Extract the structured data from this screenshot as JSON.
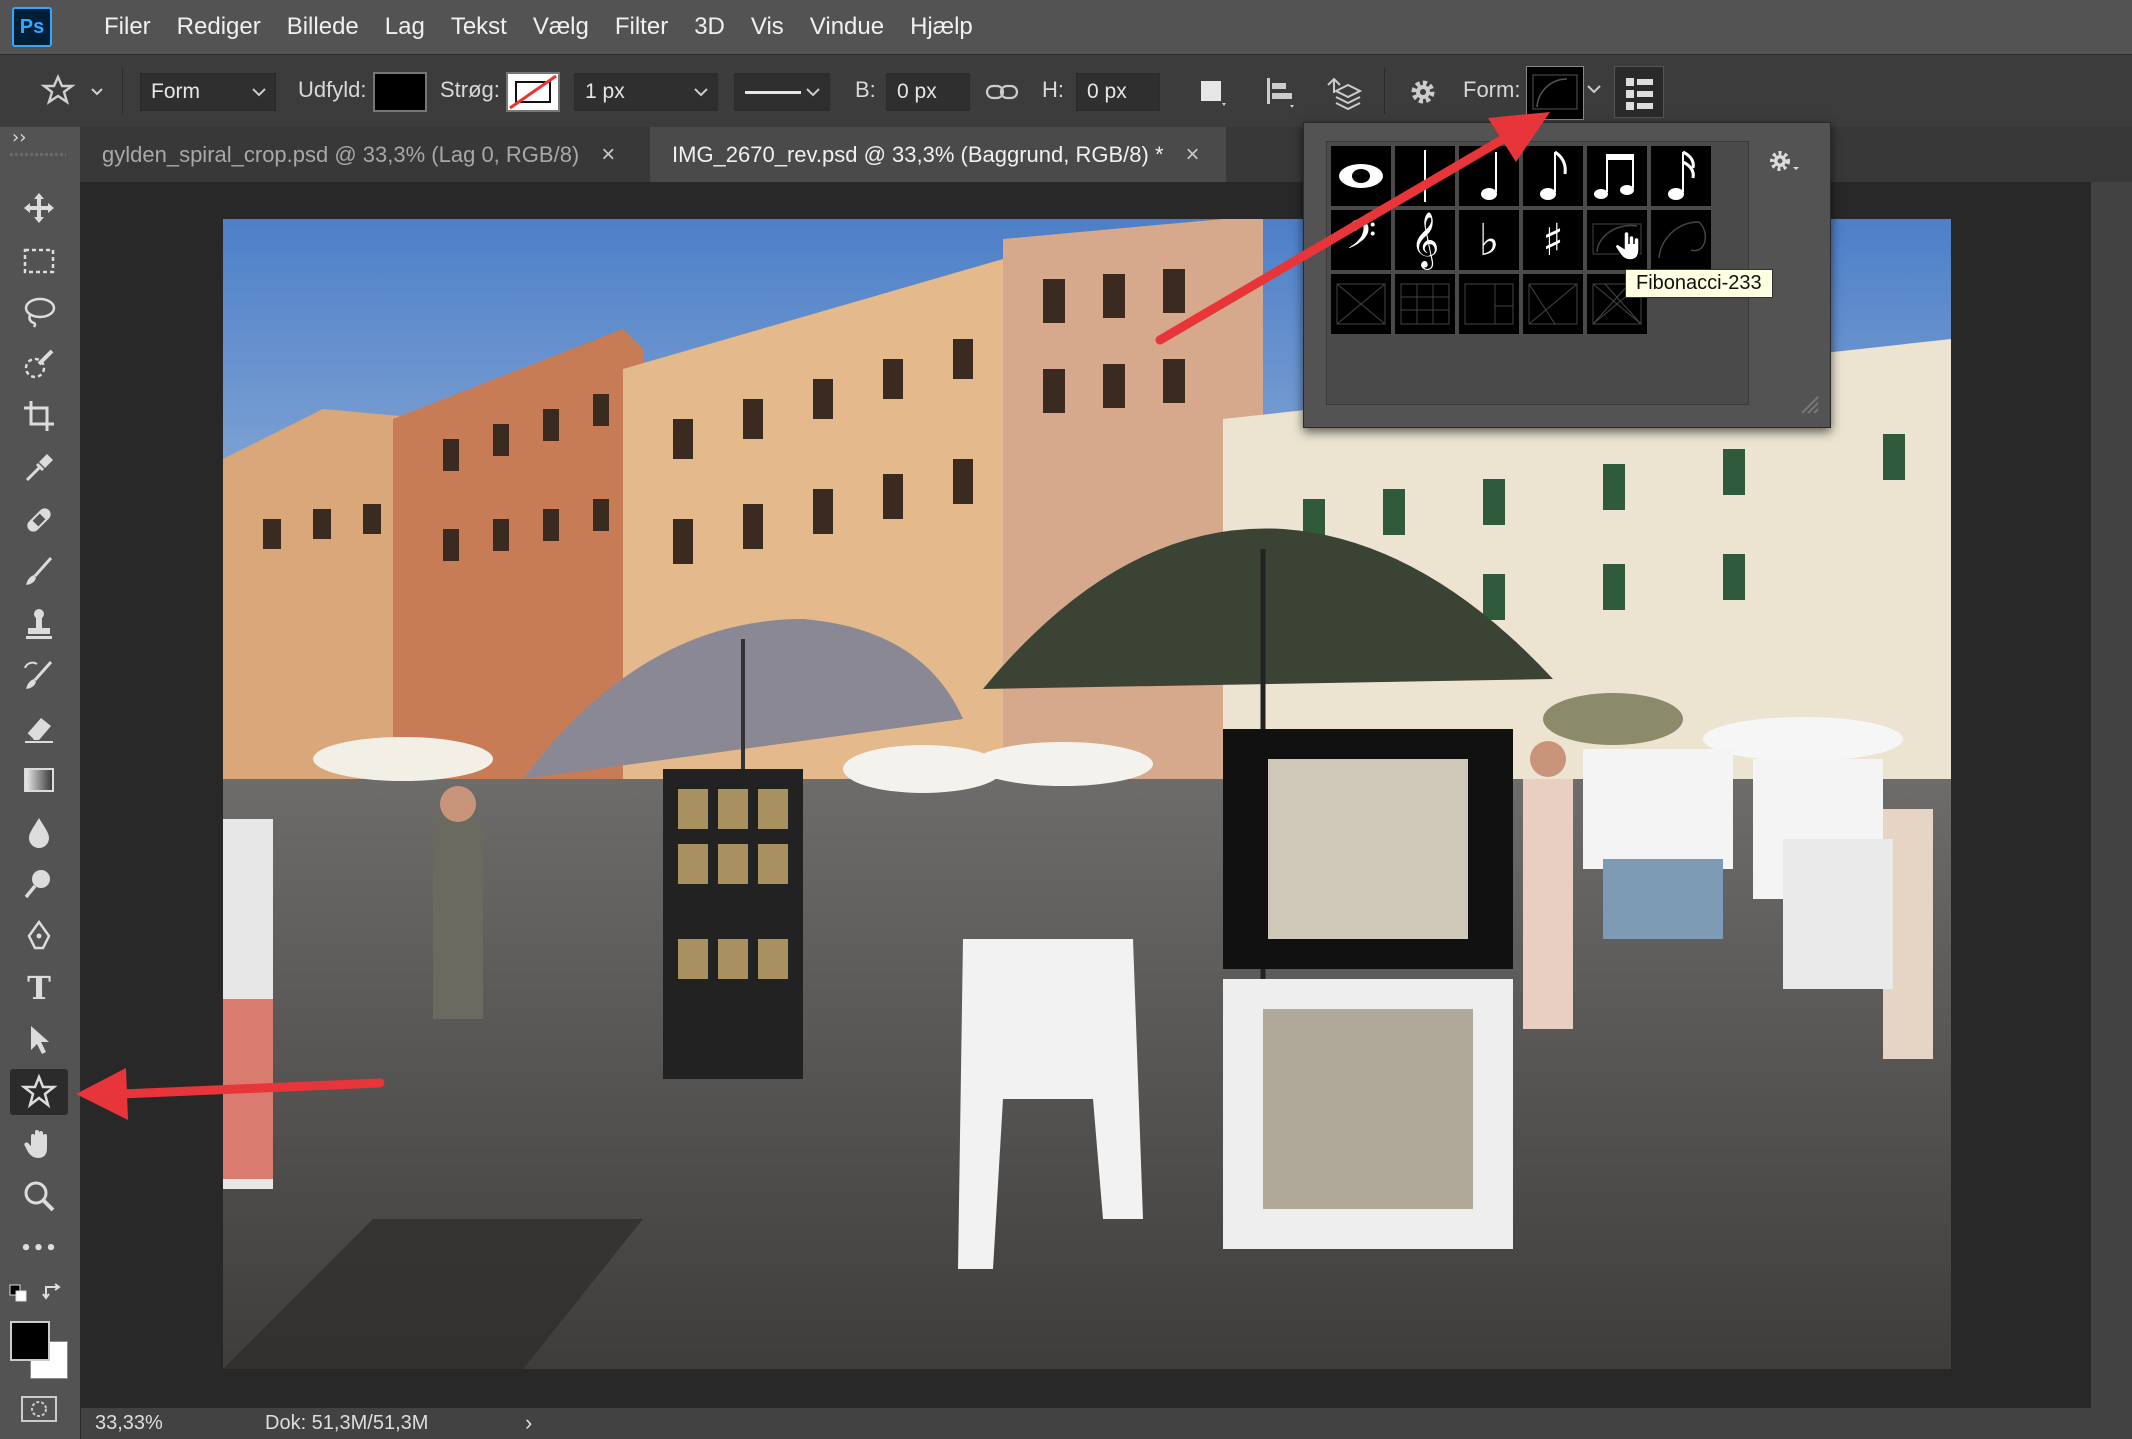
{
  "app": {
    "logo_text": "Ps",
    "accent": "#31a8ff"
  },
  "menu": [
    "Filer",
    "Rediger",
    "Billede",
    "Lag",
    "Tekst",
    "Vælg",
    "Filter",
    "3D",
    "Vis",
    "Vindue",
    "Hjælp"
  ],
  "options": {
    "mode_select": "Form",
    "fill_label": "Udfyld:",
    "stroke_label": "Strøg:",
    "stroke_width": "1 px",
    "width_label": "B:",
    "width_value": "0 px",
    "height_label": "H:",
    "height_value": "0 px",
    "shape_label": "Form:"
  },
  "tabs": [
    {
      "title": "gylden_spiral_crop.psd @ 33,3% (Lag 0, RGB/8)",
      "active": false
    },
    {
      "title": "IMG_2670_rev.psd @ 33,3% (Baggrund, RGB/8) *",
      "active": true
    }
  ],
  "tab_close_glyph": "×",
  "toolbar": {
    "expand_glyph": "››",
    "tools": [
      "move-tool",
      "marquee-tool",
      "lasso-tool",
      "quick-selection-tool",
      "crop-tool",
      "eyedropper-tool",
      "healing-brush-tool",
      "brush-tool",
      "clone-stamp-tool",
      "history-brush-tool",
      "eraser-tool",
      "gradient-tool",
      "blur-tool",
      "dodge-tool",
      "pen-tool",
      "type-tool",
      "path-selection-tool",
      "custom-shape-tool",
      "hand-tool",
      "zoom-tool",
      "more-tools"
    ],
    "type_tool_glyph": "T",
    "more_tools_glyph": "•••",
    "foreground": "#000000",
    "background": "#ffffff"
  },
  "shape_panel": {
    "shapes_row1": [
      "whole-note",
      "half-note-stem",
      "quarter-note",
      "eighth-note",
      "beamed-eighth-notes",
      "sixteenth-note"
    ],
    "shapes_row2": [
      "bass-clef",
      "treble-clef",
      "flat-sign",
      "sharp-sign",
      "fibonacci-233",
      "golden-spiral"
    ],
    "shapes_row3": [
      "grid-diagonal",
      "grid",
      "golden-ratio-grid",
      "diagonal-cross",
      "dynamic-symmetry"
    ],
    "row2_glyphs": [
      "𝄢",
      "𝄞",
      "♭",
      "♯"
    ],
    "tooltip": "Fibonacci-233"
  },
  "status": {
    "zoom": "33,33%",
    "doc": "Dok: 51,3M/51,3M",
    "arrow": "›"
  },
  "annotation_color": "#e8353a"
}
